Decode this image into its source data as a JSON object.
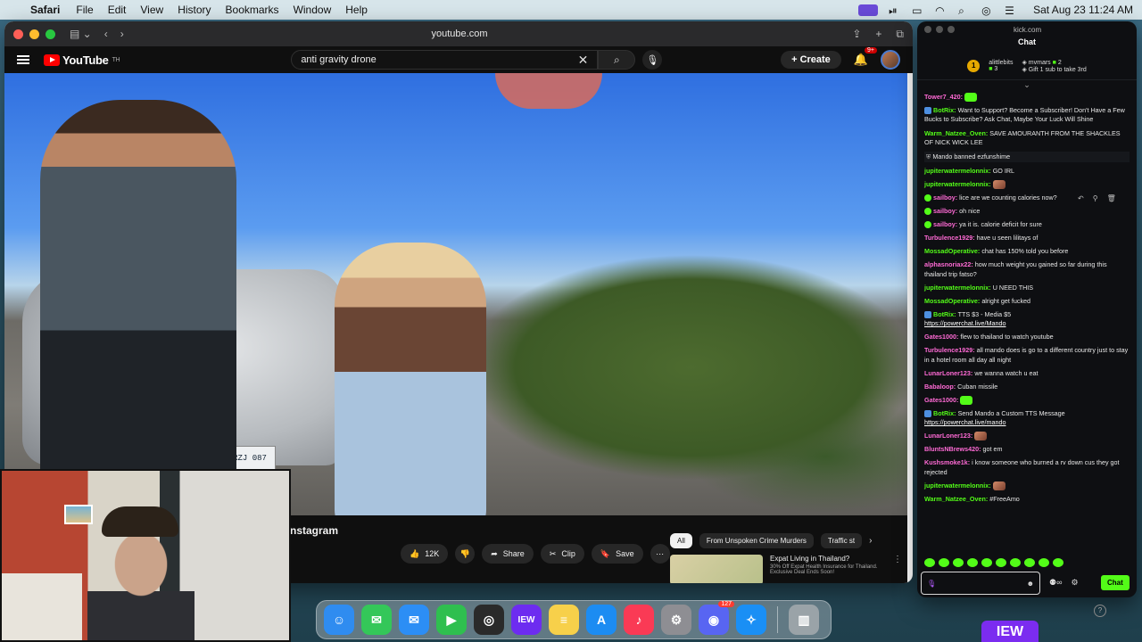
{
  "menubar": {
    "app_name": "Safari",
    "items": [
      "File",
      "Edit",
      "View",
      "History",
      "Bookmarks",
      "Window",
      "Help"
    ],
    "clock": "Sat Aug 23  11:24 AM"
  },
  "safari": {
    "url": "youtube.com"
  },
  "youtube": {
    "logo_text": "YouTube",
    "logo_region": "TH",
    "search_value": "anti gravity drone",
    "create_label": "Create",
    "notif_badge": "9+",
    "video_title": "nstagram",
    "plate_text": "RZJ 087",
    "like_count": "12K",
    "share_label": "Share",
    "clip_label": "Clip",
    "save_label": "Save",
    "chips": [
      "All",
      "From Unspoken Crime Murders",
      "Traffic st"
    ],
    "ad": {
      "title": "Expat Living in Thailand?",
      "subtitle": "30% Off Expat Health Insurance for Thailand. Exclusive Deal Ends Soon!"
    }
  },
  "kick": {
    "url": "kick.com",
    "title": "Chat",
    "pinned": {
      "rank": "1",
      "user1": "alittlebits",
      "user1_count": "3",
      "user2": "mvmars",
      "user2_count": "2",
      "message": "Gift 1 sub to take 3rd"
    },
    "messages": [
      {
        "user": "Tower7_420:",
        "color": "#ff6ad5",
        "text": "",
        "emote": "green"
      },
      {
        "user": "BotRix:",
        "color": "#53fc18",
        "text": "Want to Support? Become a Subscriber! Don't Have a Few Bucks to Subscribe? Ask Chat, Maybe Your Luck Will Shine",
        "badge": "bot"
      },
      {
        "user": "Warm_Natzee_Oven:",
        "color": "#53fc18",
        "text": "SAVE AMOURANTH FROM THE SHACKLES OF NICK WICK LEE"
      },
      {
        "user": "",
        "color": "#bdbdbd",
        "text": "Mando banned ezfunshime",
        "system": true
      },
      {
        "user": "jupiterwatermelonnix:",
        "color": "#53fc18",
        "text": "GO IRL"
      },
      {
        "user": "jupiterwatermelonnix:",
        "color": "#53fc18",
        "text": "",
        "emote": "face"
      },
      {
        "user": "sailboy:",
        "color": "#ff6ad5",
        "text": "lice are we counting calories now?",
        "badge": "green"
      },
      {
        "user": "sailboy:",
        "color": "#ff6ad5",
        "text": "oh nice",
        "badge": "green"
      },
      {
        "user": "sailboy:",
        "color": "#ff6ad5",
        "text": "ya it is. calorie deficit for sure",
        "badge": "green"
      },
      {
        "user": "Turbulence1929:",
        "color": "#ff6ad5",
        "text": "have u seen lilitays of"
      },
      {
        "user": "MossadOperative:",
        "color": "#53fc18",
        "text": "chat has 150% told you before"
      },
      {
        "user": "alphasnoriax22:",
        "color": "#ff6ad5",
        "text": "how much weight you gained so far during this thailand trip fatso?"
      },
      {
        "user": "jupiterwatermelonnix:",
        "color": "#53fc18",
        "text": "U NEED THIS"
      },
      {
        "user": "MossadOperative:",
        "color": "#53fc18",
        "text": "alright get fucked"
      },
      {
        "user": "BotRix:",
        "color": "#53fc18",
        "text": "TTS $3 - Media $5",
        "link": "https://powerchat.live/Mando",
        "badge": "bot"
      },
      {
        "user": "Gates1000:",
        "color": "#ff6ad5",
        "text": "flew to thailand to watch youtube"
      },
      {
        "user": "Turbulence1929:",
        "color": "#ff6ad5",
        "text": "all mando does is go to a different country just to stay in a hotel room all day all night"
      },
      {
        "user": "LunarLoner123:",
        "color": "#ff6ad5",
        "text": "we wanna watch u eat"
      },
      {
        "user": "Babaloop:",
        "color": "#ff6ad5",
        "text": "Cuban missile"
      },
      {
        "user": "Gates1000:",
        "color": "#ff6ad5",
        "text": "",
        "emote": "green"
      },
      {
        "user": "BotRix:",
        "color": "#53fc18",
        "text": "Send Mando a Custom TTS Message",
        "link": "https://powerchat.live/mando",
        "badge": "bot"
      },
      {
        "user": "LunarLoner123:",
        "color": "#ff6ad5",
        "text": "",
        "emote": "face"
      },
      {
        "user": "BluntsNBrews420:",
        "color": "#ff6ad5",
        "text": "got em"
      },
      {
        "user": "Kushsmoke1k:",
        "color": "#ff6ad5",
        "text": "i know someone who burned a rv down cus they got rejected"
      },
      {
        "user": "jupiterwatermelonnix:",
        "color": "#53fc18",
        "text": "",
        "emote": "face"
      },
      {
        "user": "Warm_Natzee_Oven:",
        "color": "#53fc18",
        "text": "#FreeAmo"
      }
    ],
    "send_label": "Chat",
    "footer_logo": "IEW"
  },
  "dock": {
    "items": [
      {
        "name": "finder-icon",
        "color": "#2f8cf0",
        "glyph": "☺"
      },
      {
        "name": "messages-icon",
        "color": "#34c759",
        "glyph": "✉"
      },
      {
        "name": "mail-icon",
        "color": "#2c8ef5",
        "glyph": "✉"
      },
      {
        "name": "facetime-icon",
        "color": "#2fbf4f",
        "glyph": "▶"
      },
      {
        "name": "obs-icon",
        "color": "#2a2a2a",
        "glyph": "◎"
      },
      {
        "name": "iew-icon",
        "color": "#6d2cf0",
        "glyph": "IEW"
      },
      {
        "name": "notes-icon",
        "color": "#f7d04a",
        "glyph": "≡"
      },
      {
        "name": "appstore-icon",
        "color": "#1c8cf2",
        "glyph": "A"
      },
      {
        "name": "music-icon",
        "color": "#fa3a55",
        "glyph": "♪"
      },
      {
        "name": "settings-icon",
        "color": "#8e8e93",
        "glyph": "⚙"
      },
      {
        "name": "discord-icon",
        "color": "#5865f2",
        "glyph": "◉",
        "badge": "127"
      },
      {
        "name": "safari-icon",
        "color": "#1a8ff5",
        "glyph": "✧"
      }
    ],
    "trash": {
      "name": "trash-icon",
      "color": "#9aa3a8",
      "glyph": "▥"
    }
  }
}
